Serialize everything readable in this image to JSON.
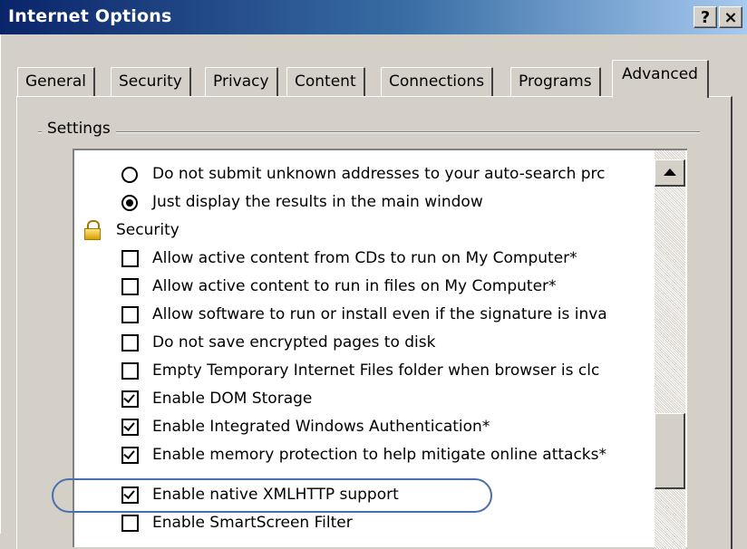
{
  "window": {
    "title": "Internet Options",
    "help_button": "?",
    "close_button": "×"
  },
  "tabs": [
    {
      "label": "General"
    },
    {
      "label": "Security"
    },
    {
      "label": "Privacy"
    },
    {
      "label": "Content"
    },
    {
      "label": "Connections"
    },
    {
      "label": "Programs"
    },
    {
      "label": "Advanced",
      "selected": true
    }
  ],
  "settings": {
    "group_label": "Settings",
    "items": [
      {
        "type": "radio",
        "checked": false,
        "label": "Do not submit unknown addresses to your auto-search prc"
      },
      {
        "type": "radio",
        "checked": true,
        "label": "Just display the results in the main window"
      },
      {
        "type": "category",
        "icon": "lock-icon",
        "label": "Security"
      },
      {
        "type": "checkbox",
        "checked": false,
        "label": "Allow active content from CDs to run on My Computer*"
      },
      {
        "type": "checkbox",
        "checked": false,
        "label": "Allow active content to run in files on My Computer*"
      },
      {
        "type": "checkbox",
        "checked": false,
        "label": "Allow software to run or install even if the signature is inva"
      },
      {
        "type": "checkbox",
        "checked": false,
        "label": "Do not save encrypted pages to disk"
      },
      {
        "type": "checkbox",
        "checked": false,
        "label": "Empty Temporary Internet Files folder when browser is clc"
      },
      {
        "type": "checkbox",
        "checked": true,
        "label": "Enable DOM Storage"
      },
      {
        "type": "checkbox",
        "checked": true,
        "label": "Enable Integrated Windows Authentication*"
      },
      {
        "type": "checkbox",
        "checked": true,
        "label": "Enable memory protection to help mitigate online attacks*"
      },
      {
        "type": "checkbox",
        "checked": true,
        "label": "Enable native XMLHTTP support",
        "highlighted": true
      },
      {
        "type": "checkbox",
        "checked": false,
        "label": "Enable SmartScreen Filter"
      }
    ]
  },
  "colors": {
    "title_gradient_start": "#0a246a",
    "title_gradient_end": "#a6caf0",
    "highlight_outline": "#4a6fb0",
    "dialog_background": "#d4d0c8"
  }
}
